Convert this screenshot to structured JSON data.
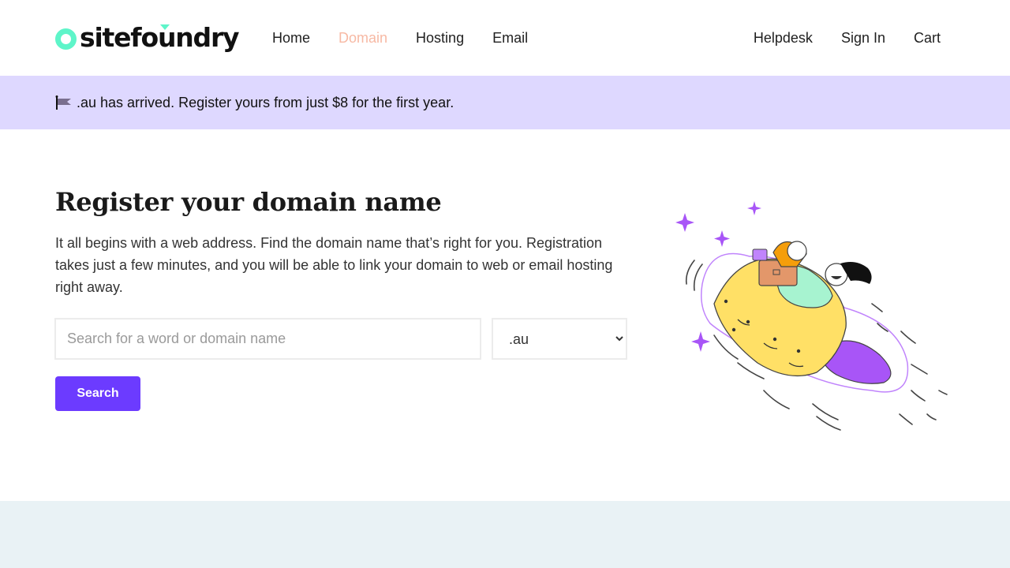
{
  "header": {
    "logo_text": "sitefoundry",
    "nav_left": [
      {
        "label": "Home"
      },
      {
        "label": "Domain"
      },
      {
        "label": "Hosting"
      },
      {
        "label": "Email"
      }
    ],
    "nav_right": [
      {
        "label": "Helpdesk"
      },
      {
        "label": "Sign In"
      },
      {
        "label": "Cart"
      }
    ]
  },
  "banner": {
    "text": ".au has arrived. Register yours from just $8 for the first year.",
    "icon": "flag-icon"
  },
  "main": {
    "title": "Register your domain name",
    "description": "It all begins with a web address. Find the domain name that’s right for you. Registration takes just a few minutes, and you will be able to link your domain to web or email hosting right away.",
    "search_placeholder": "Search for a word or domain name",
    "search_value": "",
    "tld_selected": ".au",
    "search_button": "Search"
  },
  "colors": {
    "brand_accent": "#5ef5c9",
    "nav_active": "#f7b9a4",
    "banner_bg": "#ded8ff",
    "button_bg": "#6c3bff",
    "bottom_bg": "#e9f2f5",
    "illustration_rocket": "#ffe066",
    "illustration_flame": "#a855f7"
  }
}
